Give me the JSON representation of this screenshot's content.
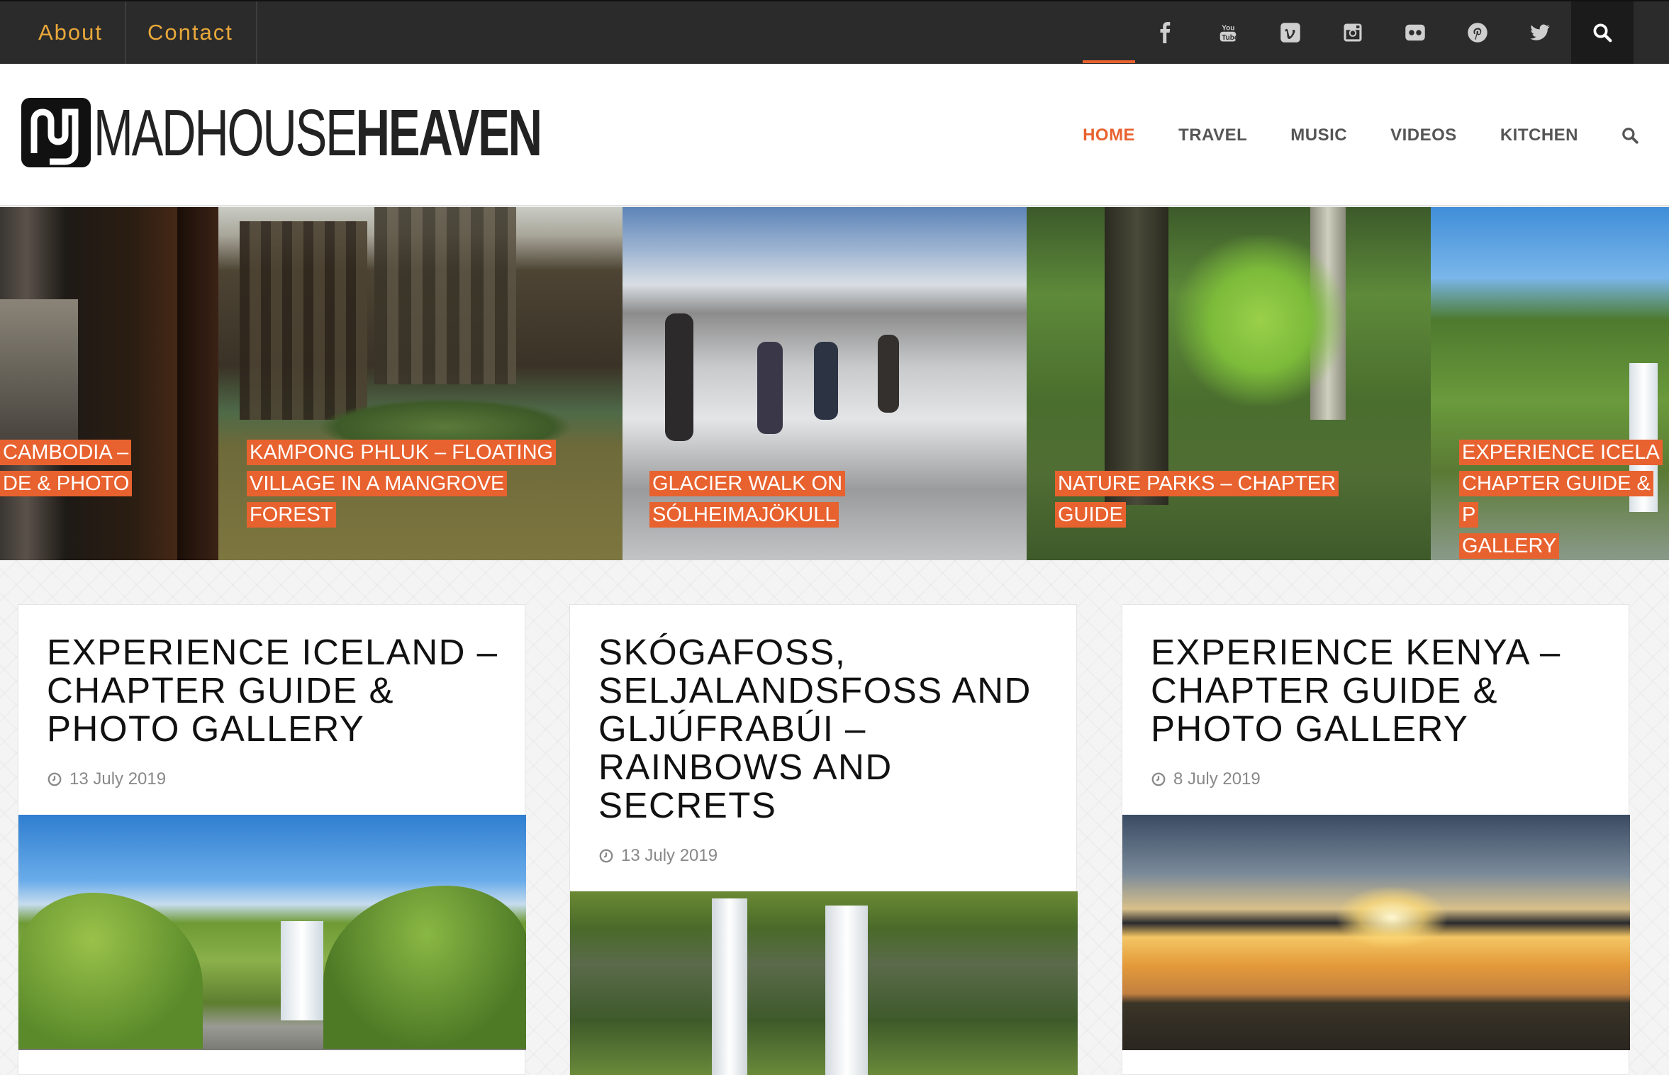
{
  "top_nav": {
    "about": "About",
    "contact": "Contact"
  },
  "social_icons": [
    "facebook-icon",
    "youtube-icon",
    "vimeo-icon",
    "instagram-icon",
    "flickr-icon",
    "pinterest-icon",
    "twitter-icon",
    "search-icon"
  ],
  "logo": {
    "text_light": "MADHOUSE",
    "text_bold": "HEAVEN"
  },
  "main_nav": {
    "home": "HOME",
    "travel": "TRAVEL",
    "music": "MUSIC",
    "videos": "VIDEOS",
    "kitchen": "KITCHEN",
    "active": "HOME"
  },
  "slider": [
    {
      "title_line1": "CAMBODIA –",
      "title_line2": "DE & PHOTO"
    },
    {
      "title_line1": "KAMPONG PHLUK – FLOATING",
      "title_line2": "VILLAGE IN A MANGROVE",
      "title_line3": "FOREST"
    },
    {
      "title_line1": "GLACIER WALK ON",
      "title_line2": "SÓLHEIMAJÖKULL"
    },
    {
      "title_line1": "NATURE PARKS – CHAPTER",
      "title_line2": "GUIDE"
    },
    {
      "title_line1": "EXPERIENCE ICELA",
      "title_line2": "CHAPTER GUIDE & P",
      "title_line3": "GALLERY"
    }
  ],
  "posts": [
    {
      "title": "EXPERIENCE ICELAND – CHAPTER GUIDE & PHOTO GALLERY",
      "date": "13 July 2019"
    },
    {
      "title": "SKÓGAFOSS, SELJALANDSFOSS AND GLJÚFRABÚI – RAINBOWS AND SECRETS",
      "date": "13 July 2019"
    },
    {
      "title": "EXPERIENCE KENYA – CHAPTER GUIDE & PHOTO GALLERY",
      "date": "8 July 2019"
    }
  ],
  "colors": {
    "accent": "#e8622f",
    "topbar": "#2b2b2b",
    "topnav_text": "#e9a83a"
  }
}
